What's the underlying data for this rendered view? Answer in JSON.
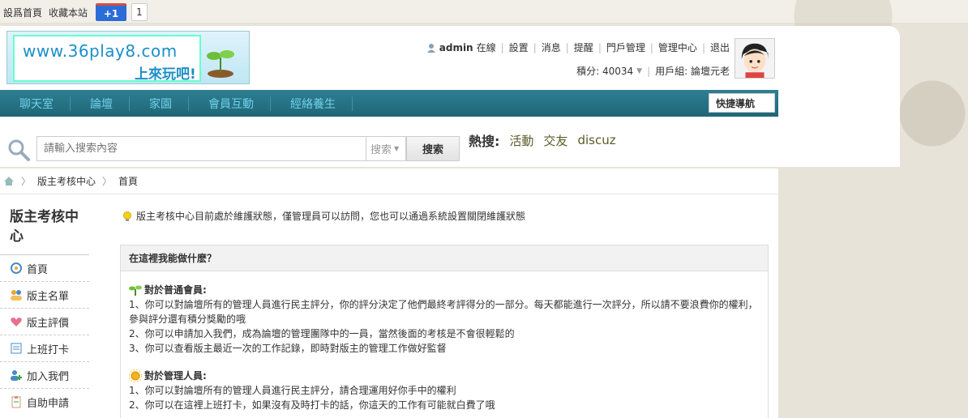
{
  "topbar": {
    "set_home": "設爲首頁",
    "bookmark": "收藏本站",
    "plusone_label": "+1",
    "plusone_count": "1"
  },
  "logo": {
    "url_text": "www.36play8.com",
    "slogan": "上來玩吧!"
  },
  "user": {
    "name": "admin",
    "online": "在線",
    "links": [
      "設置",
      "消息",
      "提醒",
      "門戶管理",
      "管理中心",
      "退出"
    ],
    "credits_label": "積分: 40034",
    "group_label": "用戶組: 論壇元老"
  },
  "nav": {
    "items": [
      "聊天室",
      "論壇",
      "家園",
      "會員互動",
      "經絡養生"
    ],
    "quick_nav": "快捷導航"
  },
  "search": {
    "placeholder": "請輸入搜索內容",
    "type": "搜索",
    "button": "搜索",
    "hot_label": "熱搜:",
    "hot_words": [
      "活動",
      "交友",
      "discuz"
    ]
  },
  "breadcrumb": {
    "items": [
      "版主考核中心",
      "首頁"
    ]
  },
  "sidebar": {
    "title": "版主考核中心",
    "items": [
      "首頁",
      "版主名單",
      "版主評價",
      "上班打卡",
      "加入我們",
      "自助申請"
    ]
  },
  "notice": "版主考核中心目前處於維護狀態，僅管理員可以訪問，您也可以通過系統設置關閉維護狀態",
  "panel": {
    "title": "在這裡我能做什麽？",
    "section1_title": "對於普通會員:",
    "section1_lines": [
      "1、你可以對論壇所有的管理人員進行民主評分，你的評分決定了他們最終考評得分的一部分。每天都能進行一次評分，所以請不要浪費你的權利，",
      "參與評分還有積分獎勵的哦",
      "2、你可以申請加入我們，成為論壇的管理團隊中的一員，當然後面的考核是不會很輕鬆的",
      "3、你可以查看版主最近一次的工作記錄，即時對版主的管理工作做好監督"
    ],
    "section2_title": "對於管理人員:",
    "section2_lines": [
      "1、你可以對論壇所有的管理人員進行民主評分，請合理運用好你手中的權利",
      "2、你可以在這裡上班打卡，如果沒有及時打卡的話，你這天的工作有可能就白費了哦"
    ]
  },
  "colors": {
    "nav_bg": "#2b7789",
    "nav_text": "#6fd0e8",
    "hot_word": "#5b5b2a"
  }
}
